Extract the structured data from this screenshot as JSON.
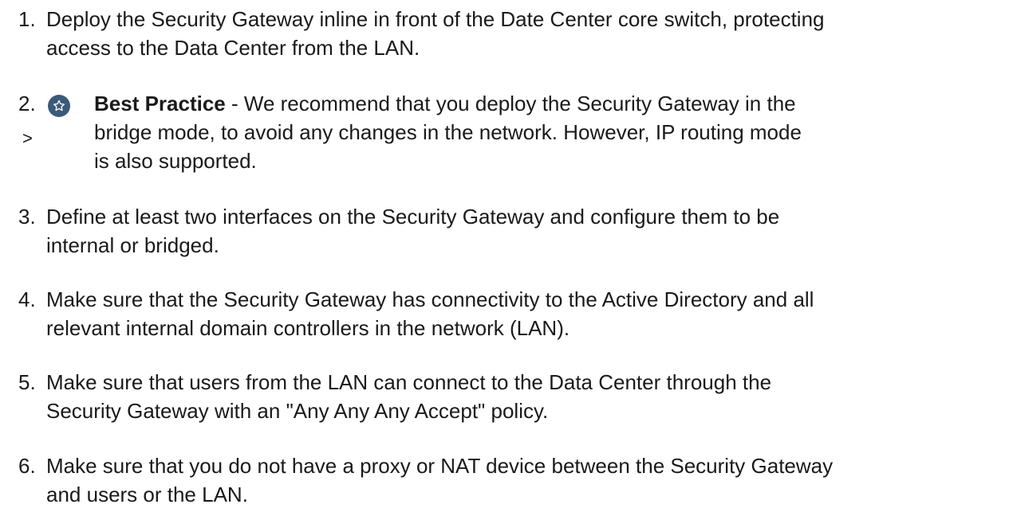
{
  "steps": [
    {
      "number": "1.",
      "lines": [
        "Deploy the Security Gateway inline in front of the Date Center core switch, protecting",
        "access to the Data Center from the LAN."
      ]
    },
    {
      "number": "2.",
      "marker": ">",
      "icon": "star-icon",
      "label": "Best Practice",
      "lines": [
        " - We recommend that you deploy the Security Gateway in the",
        "bridge mode, to avoid any changes in the network. However, IP routing mode",
        "is also supported."
      ]
    },
    {
      "number": "3.",
      "lines": [
        "Define at least two interfaces on the Security Gateway and configure them to be",
        "internal or bridged."
      ]
    },
    {
      "number": "4.",
      "lines": [
        "Make sure that the Security Gateway has connectivity to the Active Directory and all",
        "relevant internal domain controllers in the network (LAN)."
      ]
    },
    {
      "number": "5.",
      "lines": [
        "Make sure that users from the LAN can connect to the Data Center through the",
        "Security Gateway with an \"Any Any Any Accept\" policy."
      ]
    },
    {
      "number": "6.",
      "lines": [
        "Make sure that you do not have a proxy or NAT device between the Security Gateway",
        "and users or the LAN."
      ]
    }
  ],
  "colors": {
    "text": "#1a1a1a",
    "icon_background": "#3b5a7a"
  }
}
